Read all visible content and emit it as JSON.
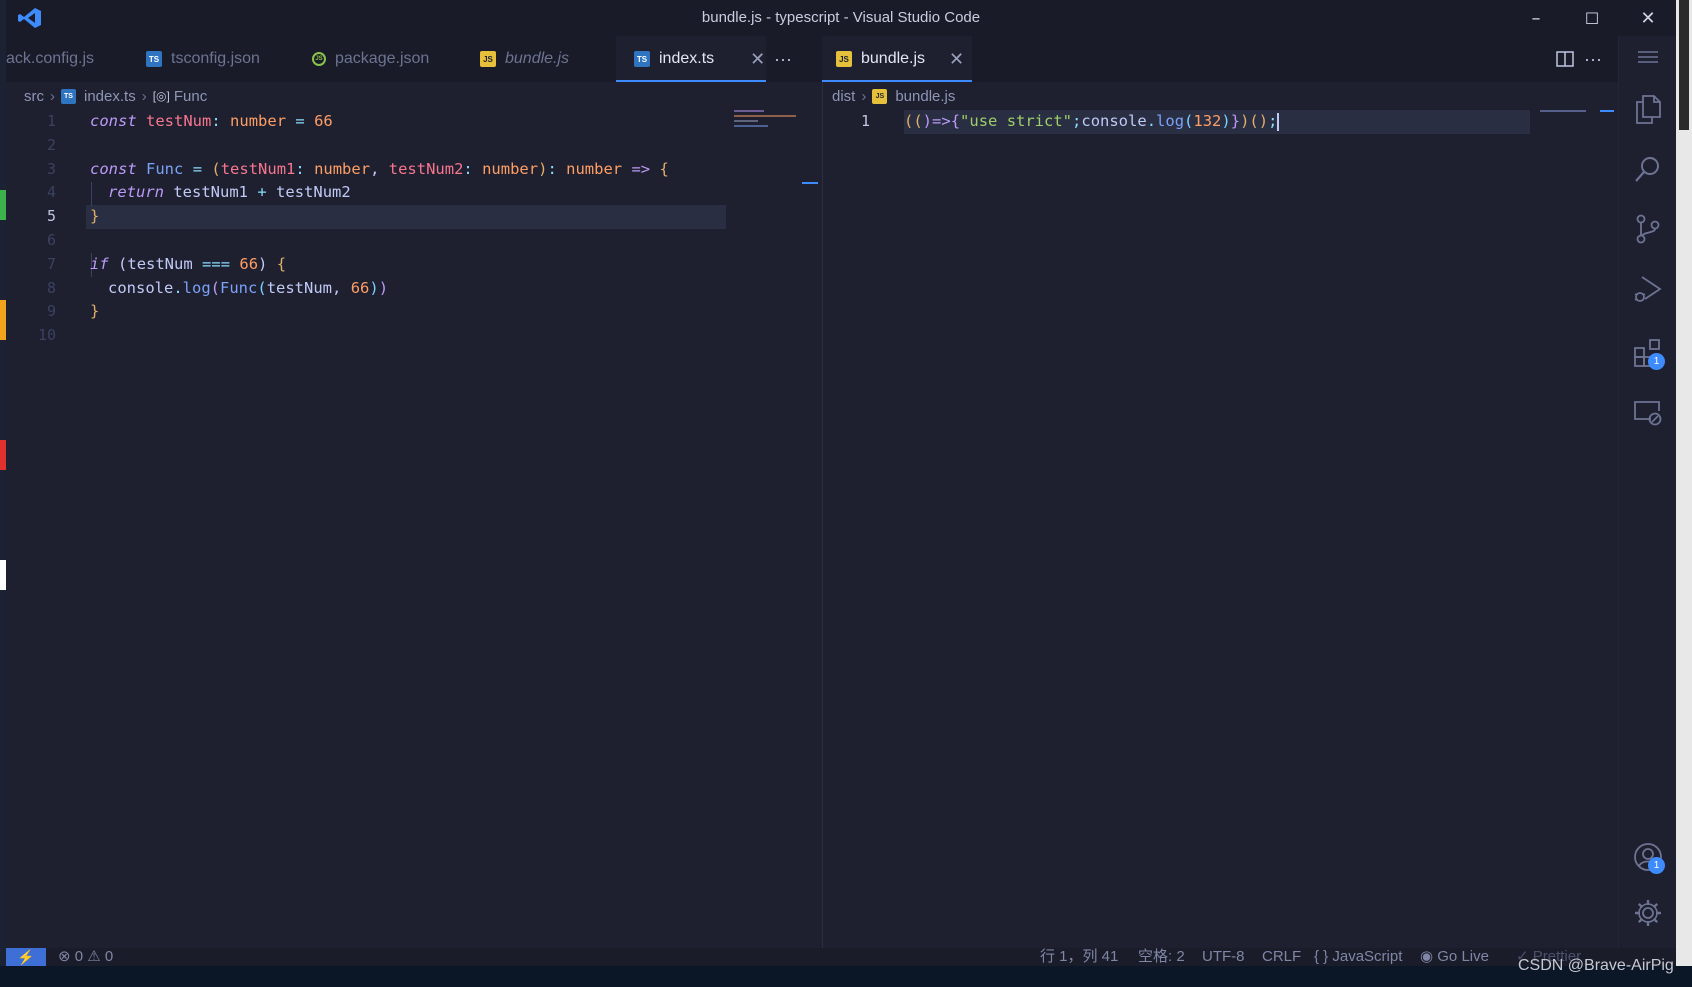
{
  "window": {
    "title": "bundle.js - typescript - Visual Studio Code",
    "minimize": "–",
    "maximize": "☐",
    "close": "✕"
  },
  "left_group": {
    "tabs": [
      {
        "label": "ack.config.js",
        "icon": "webpack-file-icon"
      },
      {
        "label": "tsconfig.json",
        "icon": "ts",
        "icon_text": "TS"
      },
      {
        "label": "package.json",
        "icon": "json",
        "icon_text": "JS"
      },
      {
        "label": "bundle.js",
        "icon": "js",
        "icon_text": "JS",
        "italic": true
      },
      {
        "label": "index.ts",
        "icon": "ts",
        "icon_text": "TS",
        "active": true,
        "close": "✕"
      }
    ],
    "more": "···",
    "breadcrumb": {
      "folder": "src",
      "file": "index.ts",
      "file_icon_text": "TS",
      "symbol_icon": "[◎]",
      "symbol": "Func",
      "sep": "›"
    },
    "line_numbers": [
      "1",
      "2",
      "3",
      "4",
      "5",
      "6",
      "7",
      "8",
      "9",
      "10"
    ],
    "current_line": 5,
    "code": {
      "l1": {
        "k": "const",
        "v": "testNum",
        "c": ":",
        "t": "number",
        "eq": "=",
        "n": "66"
      },
      "l3": {
        "k": "const",
        "f": "Func",
        "eq": "=",
        "p1": "(",
        "a1": "testNum1",
        "c1": ":",
        "t1": "number",
        "comma": ",",
        "a2": "testNum2",
        "c2": ":",
        "t2": "number",
        "p2": ")",
        "c3": ":",
        "t3": "number",
        "arrow": "=>",
        "b": "{"
      },
      "l4": {
        "k": "return",
        "a": "testNum1",
        "plus": "+",
        "b": "testNum2"
      },
      "l5": {
        "b": "}"
      },
      "l7": {
        "k": "if",
        "p1": "(",
        "v": "testNum",
        "op": "===",
        "n": "66",
        "p2": ")",
        "b": "{"
      },
      "l8": {
        "obj": "console",
        "dot": ".",
        "m": "log",
        "p1": "(",
        "f": "Func",
        "p2": "(",
        "a": "testNum",
        "comma": ",",
        "n": "66",
        "p3": ")",
        "p4": ")"
      },
      "l9": {
        "b": "}"
      }
    }
  },
  "right_group": {
    "tab": {
      "label": "bundle.js",
      "icon_text": "JS",
      "close": "✕"
    },
    "split_icon": "split-editor-icon",
    "more": "···",
    "breadcrumb": {
      "folder": "dist",
      "file": "bundle.js",
      "file_icon_text": "JS",
      "sep": "›"
    },
    "line_numbers": [
      "1"
    ],
    "code": {
      "p1": "((",
      "p2": ")",
      "arrow": "=>",
      "b1": "{",
      "s": "\"use strict\"",
      "semi1": ";",
      "obj": "console",
      "dot": ".",
      "m": "log",
      "p3": "(",
      "n": "132",
      "p4": ")",
      "b2": "}",
      "p5": ")",
      "p6": "()",
      "semi2": ";"
    }
  },
  "activity_bar": {
    "menu": "menu-icon",
    "items": [
      {
        "icon": "explorer-icon"
      },
      {
        "icon": "search-icon"
      },
      {
        "icon": "source-control-icon"
      },
      {
        "icon": "run-debug-icon"
      },
      {
        "icon": "extensions-icon",
        "badge": "1"
      },
      {
        "icon": "remote-explorer-icon"
      }
    ],
    "account": {
      "icon": "account-icon",
      "badge": "1"
    },
    "settings": {
      "icon": "gear-icon"
    }
  },
  "status": {
    "remote": "⚡",
    "errors": "0",
    "warnings": "0",
    "position": "行 1，列 41",
    "spaces": "空格: 2",
    "encoding": "UTF-8",
    "eol": "CRLF",
    "language": "{ } JavaScript",
    "golive": "Go Live",
    "prettier": "✓ Prettier"
  },
  "watermark": "CSDN @Brave-AirPig"
}
